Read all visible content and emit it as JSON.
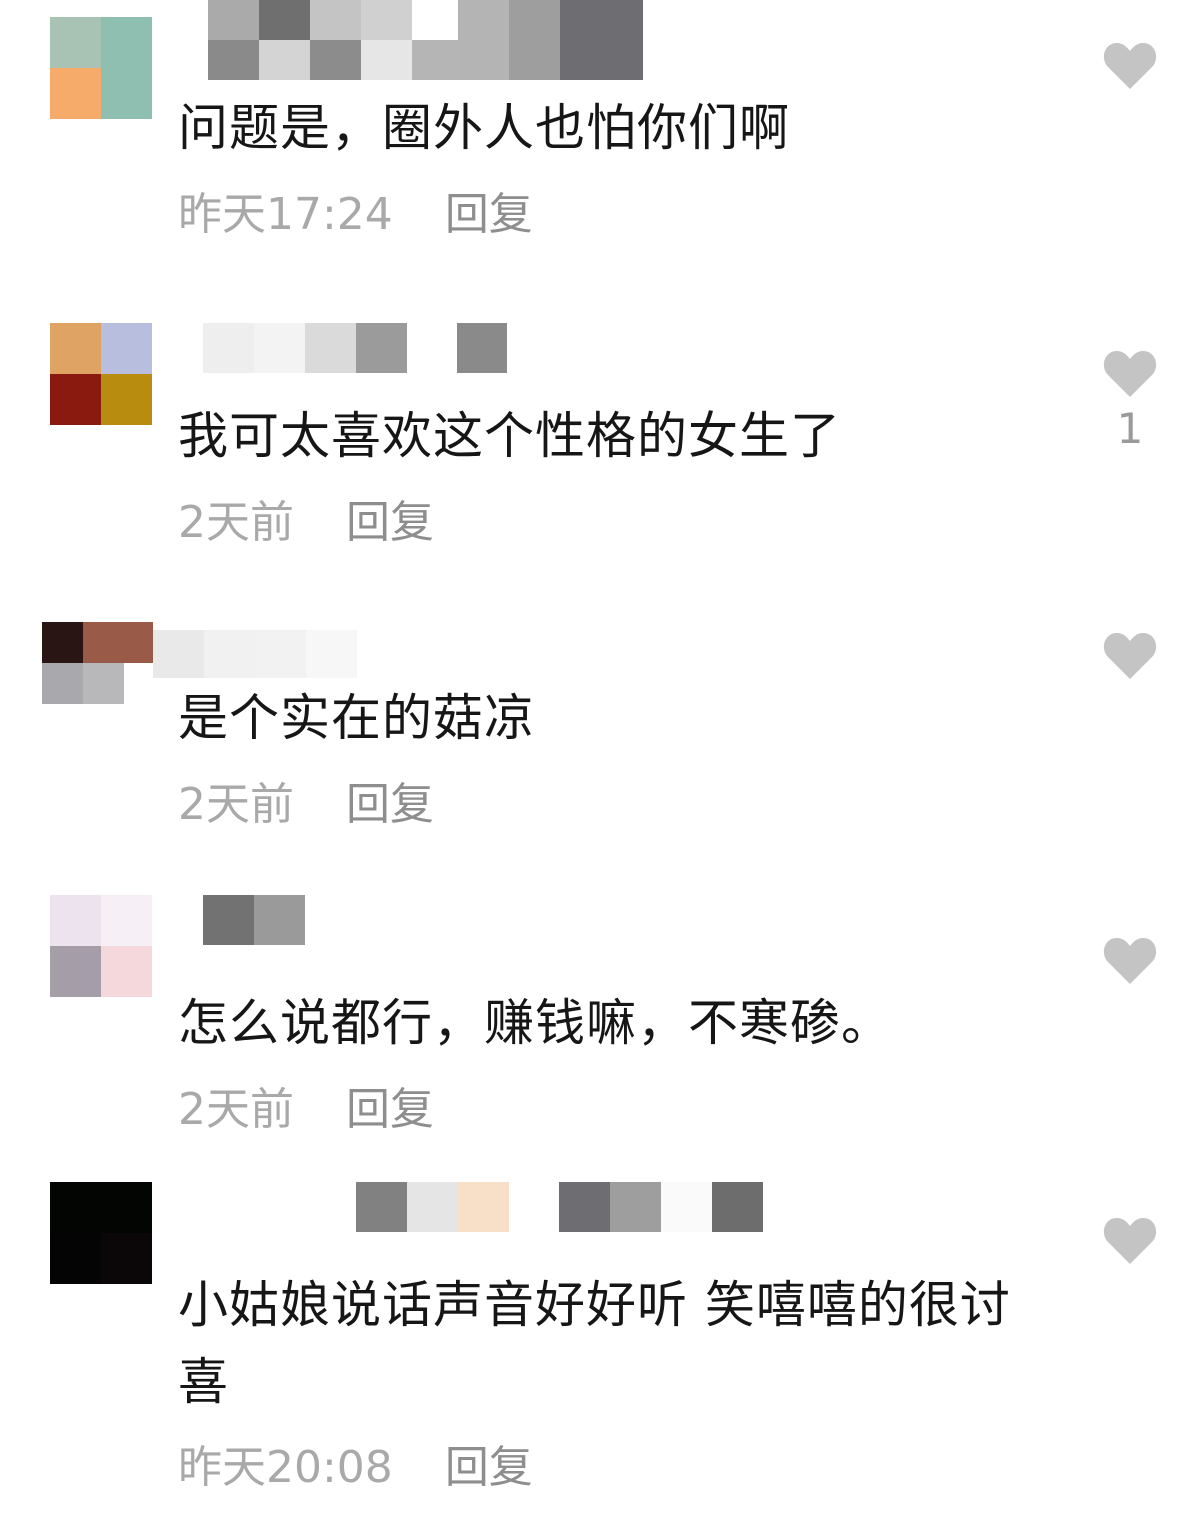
{
  "comments": [
    {
      "text": "问题是，圈外人也怕你们啊",
      "time": "昨天17:24",
      "reply_label": "回复",
      "like_count": ""
    },
    {
      "text": "我可太喜欢这个性格的女生了",
      "time": "2天前",
      "reply_label": "回复",
      "like_count": "1"
    },
    {
      "text": "是个实在的菇凉",
      "time": "2天前",
      "reply_label": "回复",
      "like_count": ""
    },
    {
      "text": "怎么说都行，赚钱嘛，不寒碜。",
      "time": "2天前",
      "reply_label": "回复",
      "like_count": ""
    },
    {
      "text": "小姑娘说话声音好好听 笑嘻嘻的很讨喜",
      "time": "昨天20:08",
      "reply_label": "回复",
      "like_count": ""
    }
  ],
  "icons": {
    "like": "heart-icon"
  },
  "colors": {
    "text": "#161616",
    "meta": "#a9a9a9",
    "heart": "#c4c4c4"
  }
}
